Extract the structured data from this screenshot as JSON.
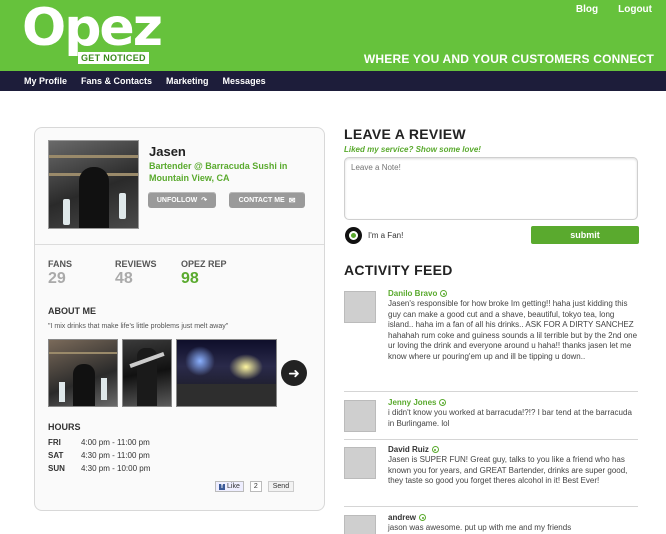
{
  "header": {
    "logo_text": "Opez",
    "logo_tagline": "GET NOTICED",
    "links": [
      "Blog",
      "Logout"
    ],
    "tagline": "WHERE YOU AND YOUR CUSTOMERS CONNECT",
    "brand_color": "#66c23c"
  },
  "nav": {
    "items": [
      "My Profile",
      "Fans & Contacts",
      "Marketing",
      "Messages"
    ],
    "bg_color": "#1d1d3a"
  },
  "profile": {
    "name": "Jasen",
    "role": "Bartender @ Barracuda Sushi in Mountain View, CA",
    "unfollow_label": "UNFOLLOW",
    "contact_label": "CONTACT ME",
    "stats": {
      "fans_label": "FANS",
      "fans_value": "29",
      "reviews_label": "REVIEWS",
      "reviews_value": "48",
      "rep_label": "OPEZ REP",
      "rep_value": "98"
    },
    "about_title": "ABOUT ME",
    "about_quote": "\"I mix drinks that make life's little problems just melt away\"",
    "next_icon": "arrow-right-icon",
    "hours_title": "HOURS",
    "hours": [
      {
        "day": "FRI",
        "time": "4:00 pm - 11:00 pm"
      },
      {
        "day": "SAT",
        "time": "4:30 pm - 11:00 pm"
      },
      {
        "day": "SUN",
        "time": "4:30 pm - 10:00 pm"
      }
    ],
    "like_label": "Like",
    "like_count": "2",
    "send_label": "Send"
  },
  "review": {
    "title": "LEAVE A REVIEW",
    "subtitle": "Liked my service? Show some love!",
    "placeholder": "Leave a Note!",
    "fan_label": "I'm a Fan!",
    "submit_label": "submit"
  },
  "activity": {
    "title": "ACTIVITY FEED",
    "items": [
      {
        "name": "Danilo Bravo",
        "text": "Jasen's responsible for how broke Im getting!! haha just kidding this guy can make a good cut and a shave, beautiful, tokyo tea, long island.. haha im a fan of all his drinks.. ASK FOR A DIRTY SANCHEZ hahahah rum coke and guiness sounds a lil terrible but by the 2nd one ur loving the drink and everyone around u haha!! thanks jasen let me know where ur pouring'em up and ill be tipping u down.."
      },
      {
        "name": "Jenny Jones",
        "text": "i didn't know you worked at barracuda!?!? I bar tend at the barracuda in Burlingame. lol"
      },
      {
        "name": "David Ruiz",
        "text": "Jasen is SUPER FUN! Great guy, talks to you like a friend who has known you for years, and GREAT Bartender, drinks are super good, they taste so good you forget theres alcohol in it! Best Ever!"
      },
      {
        "name": "andrew",
        "text": "jason was awesome. put up with me and my friends"
      }
    ]
  }
}
